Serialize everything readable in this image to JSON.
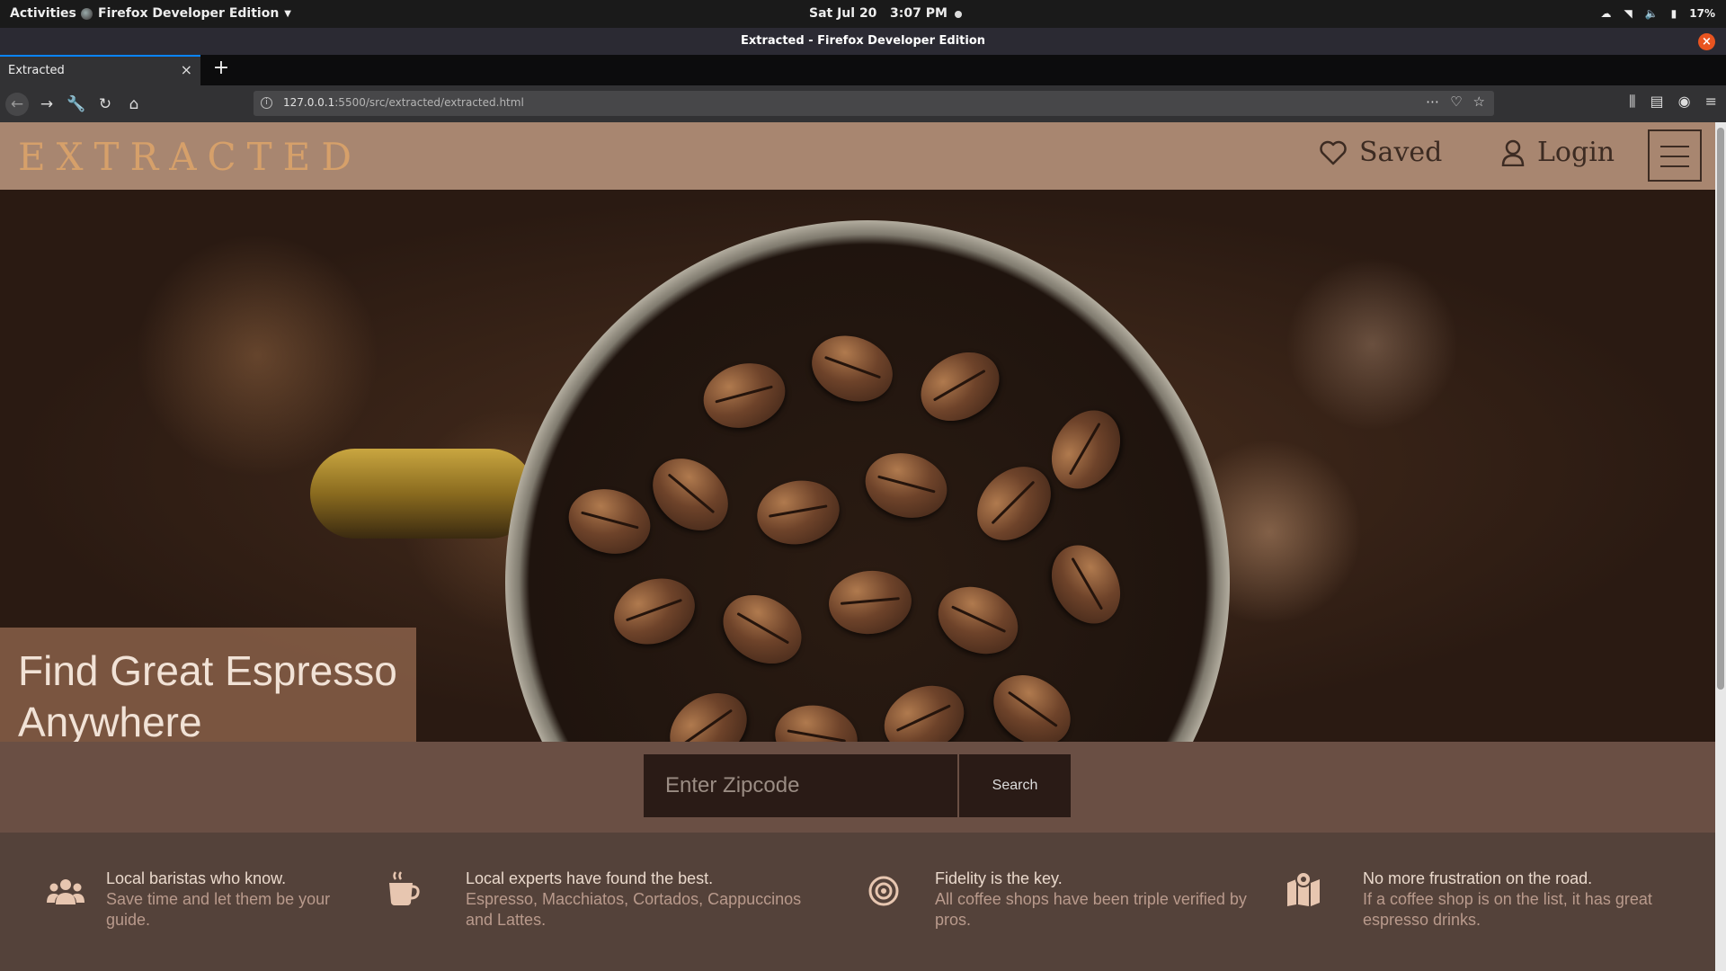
{
  "system_bar": {
    "activities": "Activities",
    "app_name": "Firefox Developer Edition",
    "clock": "Sat Jul 20   3:07 PM",
    "battery": "17%"
  },
  "window": {
    "title": "Extracted - Firefox Developer Edition"
  },
  "tabs": [
    {
      "label": "Extracted"
    }
  ],
  "url": {
    "host": "127.0.0.1",
    "rest": ":5500/src/extracted/extracted.html"
  },
  "site": {
    "logo": "EXTRACTED",
    "saved_label": "Saved",
    "login_label": "Login"
  },
  "hero": {
    "headline": "Find Great Espresso Anywhere"
  },
  "search": {
    "placeholder": "Enter Zipcode",
    "button_label": "Search"
  },
  "features": [
    {
      "icon": "users-icon",
      "title": "Local baristas who know.",
      "desc": "Save time and let them be your guide."
    },
    {
      "icon": "coffee-cup-icon",
      "title": "Local experts have found the best.",
      "desc": "Espresso, Macchiatos, Cortados, Cappuccinos and Lattes."
    },
    {
      "icon": "target-icon",
      "title": "Fidelity is the key.",
      "desc": "All coffee shops have been triple verified by pros."
    },
    {
      "icon": "map-marker-icon",
      "title": "No more frustration on the road.",
      "desc": "If a coffee shop is on the list, it has great espresso drinks."
    }
  ]
}
